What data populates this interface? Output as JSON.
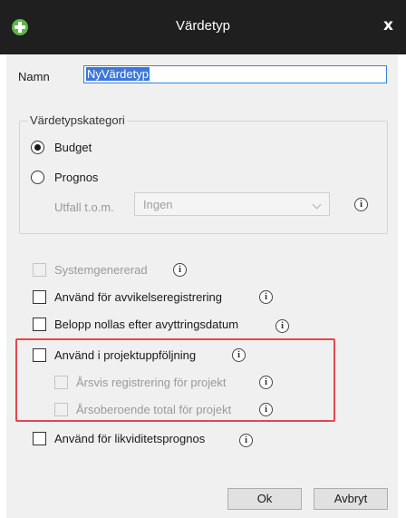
{
  "window": {
    "title": "Värdetyp",
    "close_label": "x",
    "logo_icon": "green-plus-icon"
  },
  "form": {
    "name_label": "Namn",
    "name_value": "NyVärdetyp"
  },
  "category": {
    "title": "Värdetypskategori",
    "budget_label": "Budget",
    "budget_selected": true,
    "prognos_label": "Prognos",
    "prognos_selected": false,
    "utfall_label": "Utfall t.o.m.",
    "utfall_value": "Ingen"
  },
  "options": {
    "systemgenererad": "Systemgenererad",
    "avvikelse": "Använd för avvikelseregistrering",
    "belopp": "Belopp nollas efter avyttringsdatum",
    "projektuppfoljning": "Använd i projektuppföljning",
    "arsvis": "Årsvis registrering för projekt",
    "arsoberoende": "Årsoberoende total för projekt",
    "likviditet": "Använd för likviditetsprognos"
  },
  "info_glyph": "i",
  "buttons": {
    "ok": "Ok",
    "cancel": "Avbryt"
  },
  "colors": {
    "highlight_border": "#e0484e",
    "selection": "#3b78d8",
    "titlebar": "#1f1f1f",
    "logo": "#5fb644"
  }
}
